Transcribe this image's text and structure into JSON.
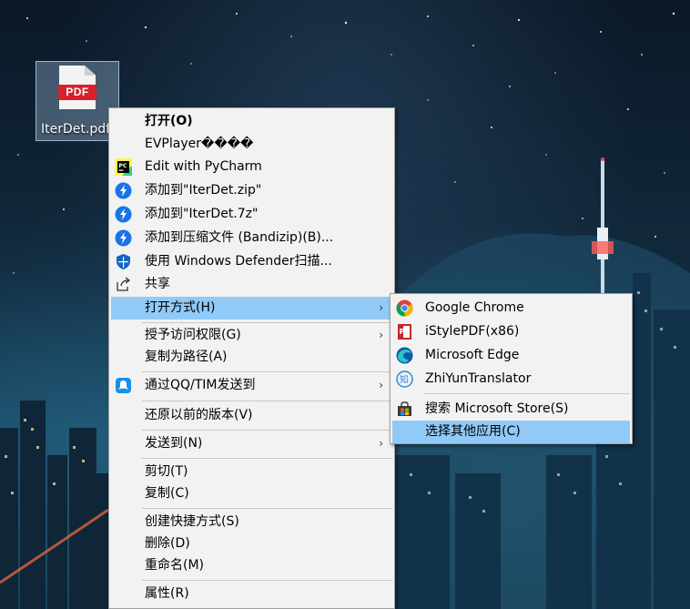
{
  "desktop": {
    "file_icon": {
      "badge": "PDF",
      "label": "IterDet.pdf"
    }
  },
  "context_menu": {
    "items": [
      {
        "label": "打开(O)",
        "bold": true
      },
      {
        "label": "EVPlayer����"
      },
      {
        "label": "Edit with PyCharm",
        "icon": "pycharm-icon"
      },
      {
        "label": "添加到\"IterDet.zip\"",
        "icon": "bandizip-icon"
      },
      {
        "label": "添加到\"IterDet.7z\"",
        "icon": "bandizip-icon"
      },
      {
        "label": "添加到压缩文件 (Bandizip)(B)...",
        "icon": "bandizip-icon"
      },
      {
        "label": "使用 Windows Defender扫描...",
        "icon": "windows-defender-shield-icon"
      },
      {
        "label": "共享",
        "icon": "share-icon"
      },
      {
        "label": "打开方式(H)",
        "highlighted": true,
        "submenu": true
      },
      {
        "label": "授予访问权限(G)",
        "submenu": true
      },
      {
        "label": "复制为路径(A)"
      },
      {
        "label": "通过QQ/TIM发送到",
        "icon": "qq-tim-icon",
        "submenu": true
      },
      {
        "label": "还原以前的版本(V)"
      },
      {
        "label": "发送到(N)",
        "submenu": true
      },
      {
        "label": "剪切(T)"
      },
      {
        "label": "复制(C)"
      },
      {
        "label": "创建快捷方式(S)"
      },
      {
        "label": "删除(D)"
      },
      {
        "label": "重命名(M)"
      },
      {
        "label": "属性(R)"
      }
    ],
    "submenu_arrow": "›"
  },
  "open_with_submenu": {
    "items": [
      {
        "label": "Google Chrome",
        "icon": "chrome-icon"
      },
      {
        "label": "iStylePDF(x86)",
        "icon": "istylepdf-icon"
      },
      {
        "label": "Microsoft Edge",
        "icon": "edge-icon"
      },
      {
        "label": "ZhiYunTranslator",
        "icon": "zhiyun-translator-icon"
      },
      {
        "label": "搜索 Microsoft Store(S)",
        "icon": "microsoft-store-icon"
      },
      {
        "label": "选择其他应用(C)",
        "highlighted": true
      }
    ]
  },
  "colors": {
    "menu_bg": "#f2f2f2",
    "highlight": "#91c9f7",
    "pdf_red": "#d8202a"
  }
}
